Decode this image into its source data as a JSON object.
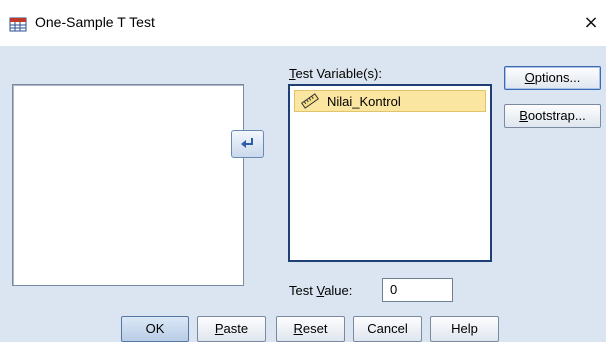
{
  "window": {
    "title": "One-Sample T Test",
    "close_glyph": "×",
    "app_icon": "spss-table-icon"
  },
  "move_button": {
    "icon": "arrow-left-icon"
  },
  "test_variables": {
    "label_mnemonic": "T",
    "label_rest": "est Variable(s):",
    "items": [
      {
        "label": "Nilai_Kontrol",
        "icon": "ruler-scale-icon"
      }
    ]
  },
  "side_buttons": {
    "options_mnemonic": "O",
    "options_rest": "ptions...",
    "bootstrap_mnemonic": "B",
    "bootstrap_rest": "ootstrap..."
  },
  "test_value": {
    "label_pre": "Test ",
    "label_mnemonic": "V",
    "label_post": "alue:",
    "value": "0"
  },
  "bottom_buttons": {
    "ok": "OK",
    "paste_mnemonic": "P",
    "paste_rest": "aste",
    "reset_mnemonic": "R",
    "reset_rest": "eset",
    "cancel": "Cancel",
    "help": "Help"
  }
}
